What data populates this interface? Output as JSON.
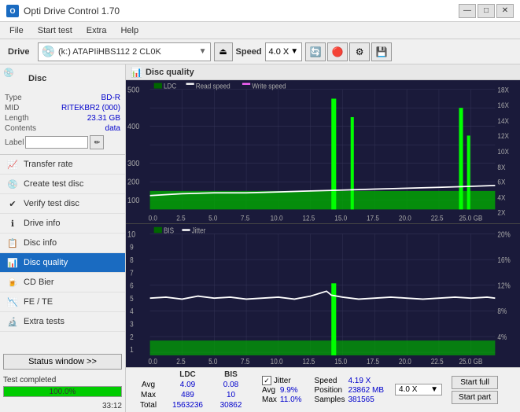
{
  "titlebar": {
    "title": "Opti Drive Control 1.70",
    "icon": "O",
    "controls": {
      "minimize": "—",
      "maximize": "□",
      "close": "✕"
    }
  },
  "menubar": {
    "items": [
      "File",
      "Start test",
      "Extra",
      "Help"
    ]
  },
  "drive_toolbar": {
    "drive_label": "Drive",
    "drive_value": "(k:) ATAPIiHBS112  2 CL0K",
    "speed_label": "Speed",
    "speed_value": "4.0 X"
  },
  "disc_panel": {
    "disc_icon": "💿",
    "rows": [
      {
        "label": "Type",
        "value": "BD-R"
      },
      {
        "label": "MID",
        "value": "RITEKBR2 (000)"
      },
      {
        "label": "Length",
        "value": "23.31 GB"
      },
      {
        "label": "Contents",
        "value": "data"
      }
    ],
    "label_placeholder": ""
  },
  "nav": {
    "items": [
      {
        "id": "transfer-rate",
        "label": "Transfer rate",
        "icon": "📈"
      },
      {
        "id": "create-test-disc",
        "label": "Create test disc",
        "icon": "💿"
      },
      {
        "id": "verify-test-disc",
        "label": "Verify test disc",
        "icon": "✔"
      },
      {
        "id": "drive-info",
        "label": "Drive info",
        "icon": "ℹ"
      },
      {
        "id": "disc-info",
        "label": "Disc info",
        "icon": "📋"
      },
      {
        "id": "disc-quality",
        "label": "Disc quality",
        "icon": "📊",
        "active": true
      },
      {
        "id": "cd-bier",
        "label": "CD Bier",
        "icon": "🍺"
      },
      {
        "id": "fe-te",
        "label": "FE / TE",
        "icon": "📉"
      },
      {
        "id": "extra-tests",
        "label": "Extra tests",
        "icon": "🔬"
      }
    ]
  },
  "status_window_btn": "Status window >>",
  "status_text": "Test completed",
  "progress_value": 100,
  "progress_text": "100.0%",
  "time_text": "33:12",
  "disc_quality_title": "Disc quality",
  "chart1": {
    "legend": [
      "LDC",
      "Read speed",
      "Write speed"
    ],
    "y_max": 500,
    "right_labels": [
      "18X",
      "16X",
      "14X",
      "12X",
      "10X",
      "8X",
      "6X",
      "4X",
      "2X"
    ],
    "x_labels": [
      "0.0",
      "2.5",
      "5.0",
      "7.5",
      "10.0",
      "12.5",
      "15.0",
      "17.5",
      "20.0",
      "22.5",
      "25.0 GB"
    ]
  },
  "chart2": {
    "legend": [
      "BIS",
      "Jitter"
    ],
    "y_max": 10,
    "right_labels": [
      "20%",
      "16%",
      "12%",
      "8%",
      "4%"
    ],
    "x_labels": [
      "0.0",
      "2.5",
      "5.0",
      "7.5",
      "10.0",
      "12.5",
      "15.0",
      "17.5",
      "20.0",
      "22.5",
      "25.0 GB"
    ]
  },
  "stats": {
    "columns": [
      "",
      "LDC",
      "BIS"
    ],
    "rows": [
      {
        "label": "Avg",
        "ldc": "4.09",
        "bis": "0.08"
      },
      {
        "label": "Max",
        "ldc": "489",
        "bis": "10"
      },
      {
        "label": "Total",
        "ldc": "1563236",
        "bis": "30862"
      }
    ],
    "jitter_checked": true,
    "jitter_label": "Jitter",
    "jitter_avg": "9.9%",
    "jitter_max": "11.0%",
    "speed_label": "Speed",
    "speed_value": "4.19 X",
    "speed_selector": "4.0 X",
    "position_label": "Position",
    "position_value": "23862 MB",
    "samples_label": "Samples",
    "samples_value": "381565",
    "btn_start_full": "Start full",
    "btn_start_part": "Start part"
  }
}
